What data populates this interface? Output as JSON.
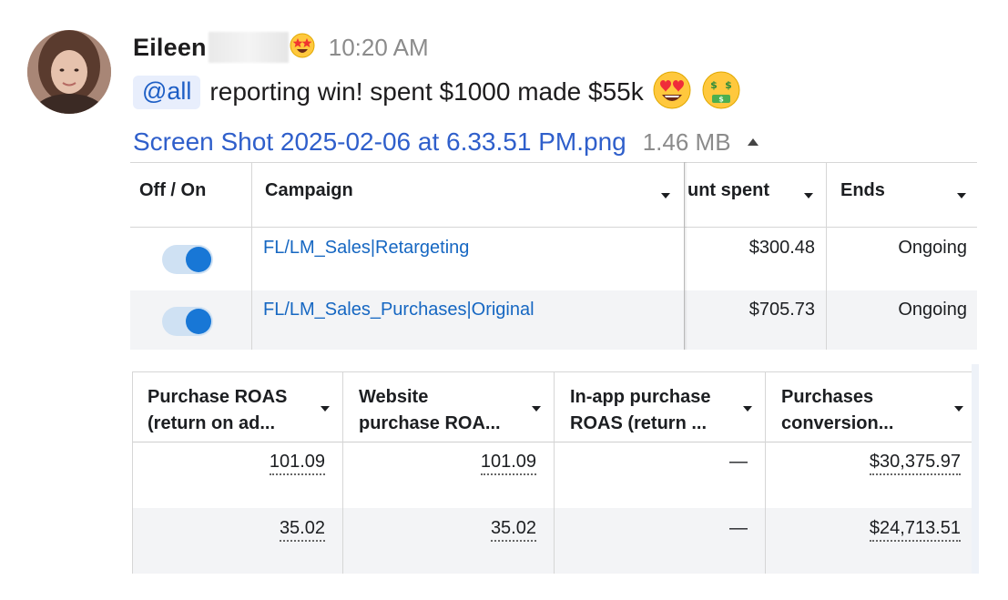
{
  "message": {
    "sender_name": "Eileen",
    "time": "10:20 AM",
    "mention": "@all",
    "text": "reporting win! spent $1000 made $55k",
    "attachment": {
      "file_name": "Screen Shot 2025-02-06 at 6.33.51 PM.png",
      "file_size": "1.46 MB"
    }
  },
  "table1": {
    "headers": [
      "Off / On",
      "Campaign",
      "unt spent",
      "Ends"
    ],
    "rows": [
      {
        "campaign": "FL/LM_Sales|Retargeting",
        "amount": "$300.48",
        "ends": "Ongoing"
      },
      {
        "campaign": "FL/LM_Sales_Purchases|Original",
        "amount": "$705.73",
        "ends": "Ongoing"
      }
    ]
  },
  "table2": {
    "headers": [
      {
        "line1": "Purchase ROAS",
        "line2": "(return on ad..."
      },
      {
        "line1": "Website",
        "line2": "purchase ROA..."
      },
      {
        "line1": "In-app purchase",
        "line2": "ROAS (return ..."
      },
      {
        "line1": "Purchases",
        "line2": "conversion..."
      }
    ],
    "rows": [
      [
        "101.09",
        "101.09",
        "—",
        "$30,375.97"
      ],
      [
        "35.02",
        "35.02",
        "—",
        "$24,713.51"
      ]
    ]
  },
  "colors": {
    "link": "#2f5fcb",
    "mention_bg": "#e8eefc",
    "toggle_on": "#1877d6"
  }
}
